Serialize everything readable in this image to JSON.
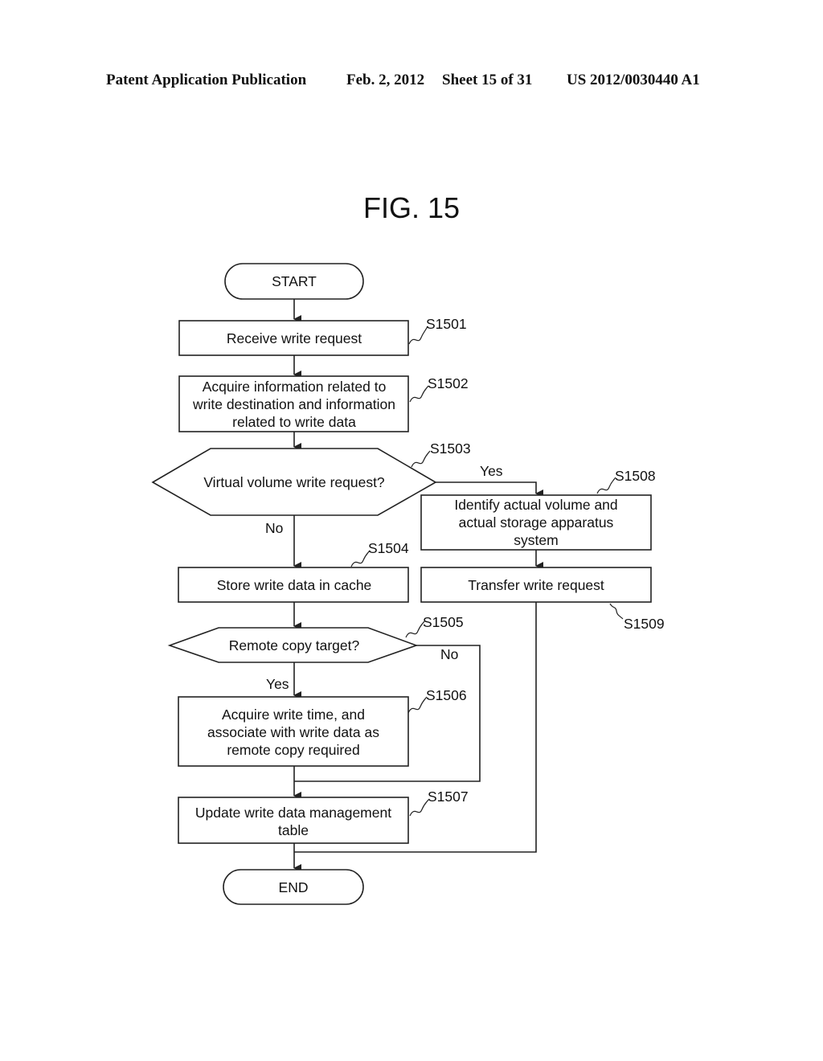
{
  "header": {
    "publication": "Patent Application Publication",
    "date": "Feb. 2, 2012",
    "sheet": "Sheet 15 of 31",
    "number": "US 2012/0030440 A1"
  },
  "figure": {
    "title": "FIG. 15"
  },
  "flowchart": {
    "start": "START",
    "end": "END",
    "steps": {
      "s1501": {
        "id": "S1501",
        "lines": [
          "Receive write request"
        ]
      },
      "s1502": {
        "id": "S1502",
        "lines": [
          "Acquire information related to",
          "write destination and information",
          "related to write data"
        ]
      },
      "s1503": {
        "id": "S1503",
        "lines": [
          "Virtual volume write request?"
        ]
      },
      "s1504": {
        "id": "S1504",
        "lines": [
          "Store write data in cache"
        ]
      },
      "s1505": {
        "id": "S1505",
        "lines": [
          "Remote copy target?"
        ]
      },
      "s1506": {
        "id": "S1506",
        "lines": [
          "Acquire write time, and",
          "associate with write data as",
          "remote copy required"
        ]
      },
      "s1507": {
        "id": "S1507",
        "lines": [
          "Update write data management",
          "table"
        ]
      },
      "s1508": {
        "id": "S1508",
        "lines": [
          "Identify actual volume and",
          "actual storage apparatus",
          "system"
        ]
      },
      "s1509": {
        "id": "S1509",
        "lines": [
          "Transfer write request"
        ]
      }
    },
    "branch_labels": {
      "s1503_yes": "Yes",
      "s1503_no": "No",
      "s1505_yes": "Yes",
      "s1505_no": "No"
    }
  }
}
